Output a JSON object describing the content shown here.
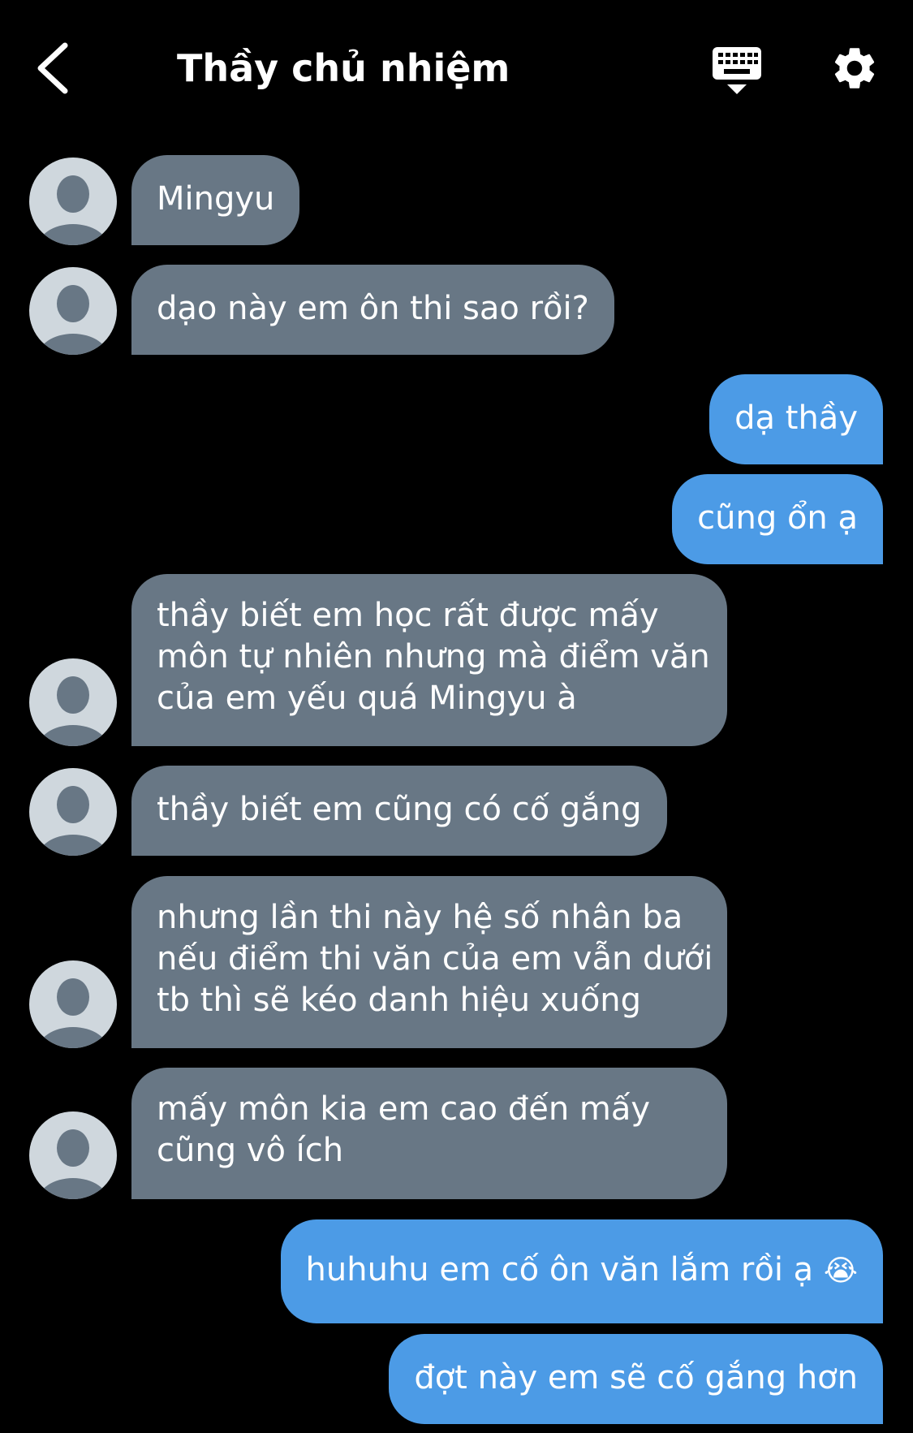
{
  "header": {
    "title": "Thầy chủ nhiệm",
    "back_icon": "chevron-left-icon",
    "keyboard_icon": "keyboard-hide-icon",
    "settings_icon": "gear-icon"
  },
  "colors": {
    "background": "#000000",
    "incoming_bubble": "#687785",
    "outgoing_bubble": "#4c9be6",
    "avatar_bg": "#cfd7dd",
    "avatar_figure": "#687785"
  },
  "messages": [
    {
      "sender": "them",
      "text": "Mingyu"
    },
    {
      "sender": "them",
      "text": "dạo này em ôn thi sao rồi?"
    },
    {
      "sender": "me",
      "text": "dạ thầy"
    },
    {
      "sender": "me",
      "text": "cũng ổn ạ"
    },
    {
      "sender": "them",
      "lines": [
        "thầy biết em học rất được mấy",
        "môn tự nhiên nhưng mà điểm văn",
        "của em yếu quá Mingyu à"
      ]
    },
    {
      "sender": "them",
      "text": "thầy biết em cũng có cố gắng"
    },
    {
      "sender": "them",
      "lines": [
        "nhưng lần thi này hệ số nhân ba",
        "nếu điểm thi văn của em vẫn dưới",
        "tb thì sẽ kéo danh hiệu xuống"
      ]
    },
    {
      "sender": "them",
      "lines": [
        "mấy môn kia em cao đến mấy",
        "cũng vô ích"
      ]
    },
    {
      "sender": "me",
      "text": "huhuhu em cố ôn văn lắm rồi ạ",
      "emoji": "😭",
      "emoji_icon": "loudly-crying-face-icon"
    },
    {
      "sender": "me",
      "text": "đợt này em sẽ cố gắng hơn"
    }
  ]
}
